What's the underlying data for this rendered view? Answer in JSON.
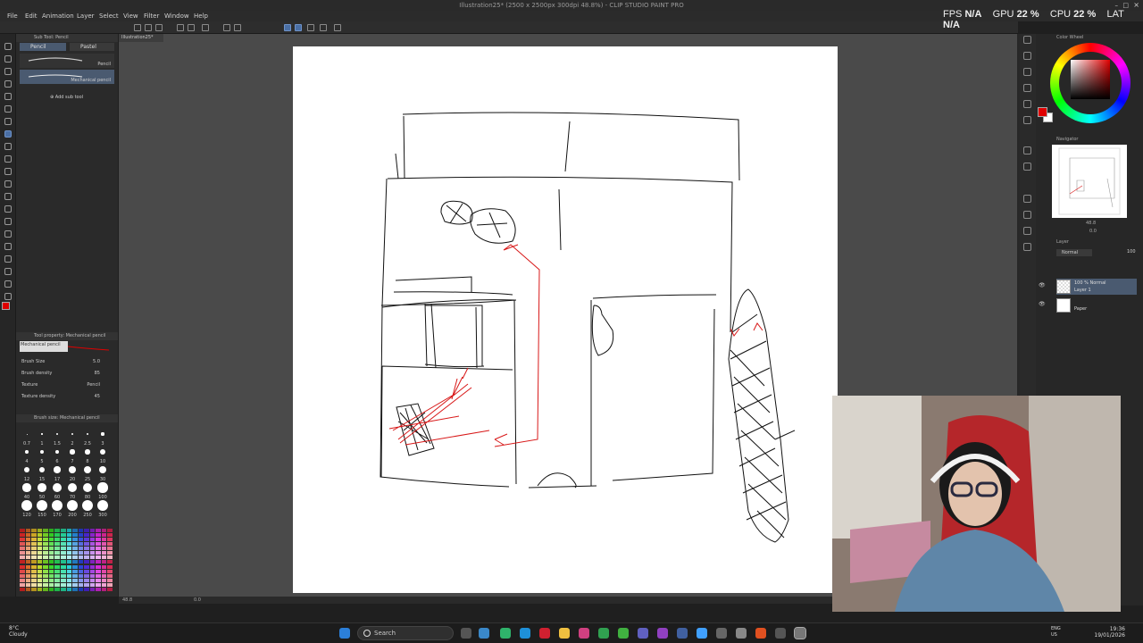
{
  "window": {
    "title": "Illustration25* (2500 x 2500px 300dpi 48.8%) - CLIP STUDIO PAINT PRO"
  },
  "menu": [
    "File",
    "Edit",
    "Animation",
    "Layer",
    "Select",
    "View",
    "Filter",
    "Window",
    "Help"
  ],
  "perf": {
    "fps_label": "FPS",
    "fps": "N/A",
    "gpu_label": "GPU",
    "gpu": "22 %",
    "cpu_label": "CPU",
    "cpu": "22 %",
    "lat_label": "LAT",
    "lat": "N/A"
  },
  "subtool": {
    "header": "Sub Tool: Pencil",
    "tabs": [
      "Pencil",
      "Pastel"
    ],
    "items": [
      "Pencil",
      "Mechanical pencil"
    ],
    "add_label": "Add sub tool"
  },
  "tool_property": {
    "header": "Tool property: Mechanical pencil",
    "name": "Mechanical pencil",
    "rows": [
      {
        "label": "Brush Size",
        "value": "5.0"
      },
      {
        "label": "Brush density",
        "value": "85"
      },
      {
        "label": "Texture",
        "value": "Pencil"
      },
      {
        "label": "Texture density",
        "value": "45"
      }
    ]
  },
  "brush_size": {
    "header": "Brush size: Mechanical pencil",
    "sizes": [
      "0.7",
      "1",
      "1.5",
      "2",
      "2.5",
      "3",
      "4",
      "5",
      "6",
      "7",
      "8",
      "10",
      "12",
      "15",
      "17",
      "20",
      "25",
      "30",
      "40",
      "50",
      "60",
      "70",
      "80",
      "100",
      "120",
      "150",
      "170",
      "200",
      "250",
      "300"
    ]
  },
  "doc_tab": "Illustration25*",
  "status": {
    "zoom": "48.8",
    "angle": "0.0"
  },
  "right": {
    "color_wheel_label": "Color Wheel",
    "navigator_label": "Navigator",
    "nav_zoom": "48.8",
    "nav_angle": "0.0",
    "layer_label": "Layer",
    "blend_mode": "Normal",
    "opacity": "100",
    "layers": [
      {
        "top": "100 % Normal",
        "name": "Layer 1"
      },
      {
        "top": "",
        "name": "Paper"
      }
    ]
  },
  "colors": {
    "main": "#e00000",
    "sub": "#ffffff",
    "accent": "#4a6fa5"
  },
  "taskbar": {
    "weather_temp": "8°C",
    "weather_desc": "Cloudy",
    "search_placeholder": "Search",
    "lang1": "ENG",
    "lang2": "US",
    "time": "19:36",
    "date": "19/01/2026"
  }
}
